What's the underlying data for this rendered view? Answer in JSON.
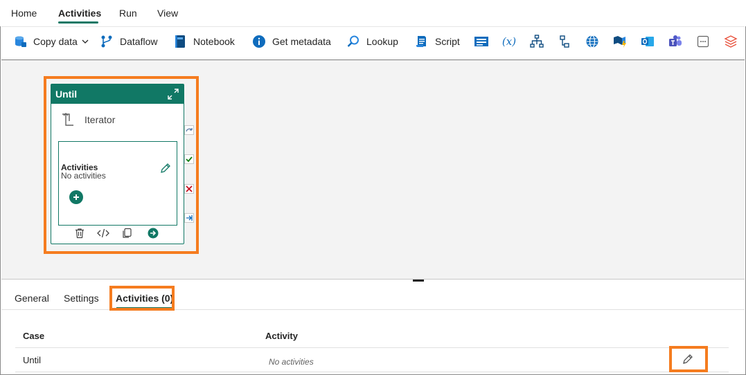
{
  "ribbon": {
    "tabs": [
      {
        "label": "Home"
      },
      {
        "label": "Activities"
      },
      {
        "label": "Run"
      },
      {
        "label": "View"
      }
    ],
    "active_tab": "Activities"
  },
  "toolbar": {
    "copy_data": "Copy data",
    "dataflow": "Dataflow",
    "notebook": "Notebook",
    "get_metadata": "Get metadata",
    "lookup": "Lookup",
    "script": "Script",
    "icons": [
      "set-variable-icon",
      "expression-icon",
      "switch-icon",
      "if-condition-icon",
      "web-icon",
      "azure-function-icon",
      "outlook-icon",
      "teams-icon",
      "more-activities-icon",
      "databricks-icon"
    ]
  },
  "canvas": {
    "until_card": {
      "title": "Until",
      "iterator_label": "Iterator",
      "activities_title": "Activities",
      "activities_sub": "No activities"
    }
  },
  "panel": {
    "tabs": [
      {
        "label": "General"
      },
      {
        "label": "Settings"
      },
      {
        "label": "Activities (0)"
      }
    ],
    "active_tab": "Activities (0)",
    "columns": [
      "Case",
      "Activity"
    ],
    "rows": [
      {
        "case": "Until",
        "activity": "No activities"
      }
    ]
  },
  "colors": {
    "accent": "#117865",
    "highlight": "#f57c1f",
    "canvas_bg": "#f3f3f3"
  }
}
